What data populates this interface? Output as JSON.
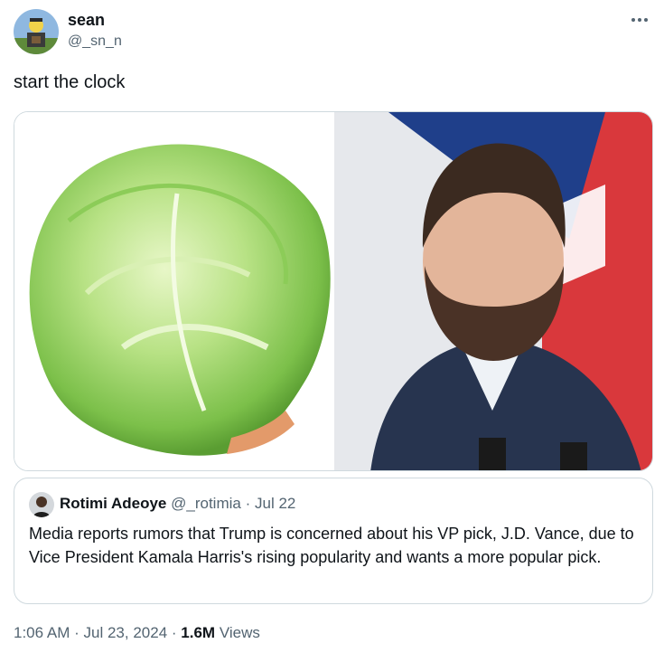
{
  "author": {
    "name": "sean",
    "handle": "@_sn_n"
  },
  "tweet": {
    "text": "start the clock"
  },
  "media": [
    {
      "description_icon": "lettuce-image"
    },
    {
      "description_icon": "portrait-image"
    }
  ],
  "quote": {
    "name": "Rotimi Adeoye",
    "handle": "@_rotimia",
    "separator": "·",
    "date": "Jul 22",
    "text": "Media reports rumors that Trump is concerned about his VP pick, J.D. Vance, due to Vice President Kamala Harris's rising popularity and wants a more popular pick."
  },
  "footer": {
    "time": "1:06 AM",
    "separator": "·",
    "date": "Jul 23, 2024",
    "views_count": "1.6M",
    "views_label": "Views"
  },
  "colors": {
    "text": "#0f1419",
    "secondary": "#536471",
    "border": "#cfd9de",
    "lettuce": "#9fd46b",
    "flag_blue": "#1f3f8a",
    "flag_red": "#d9383c",
    "jacket": "#27344f"
  }
}
